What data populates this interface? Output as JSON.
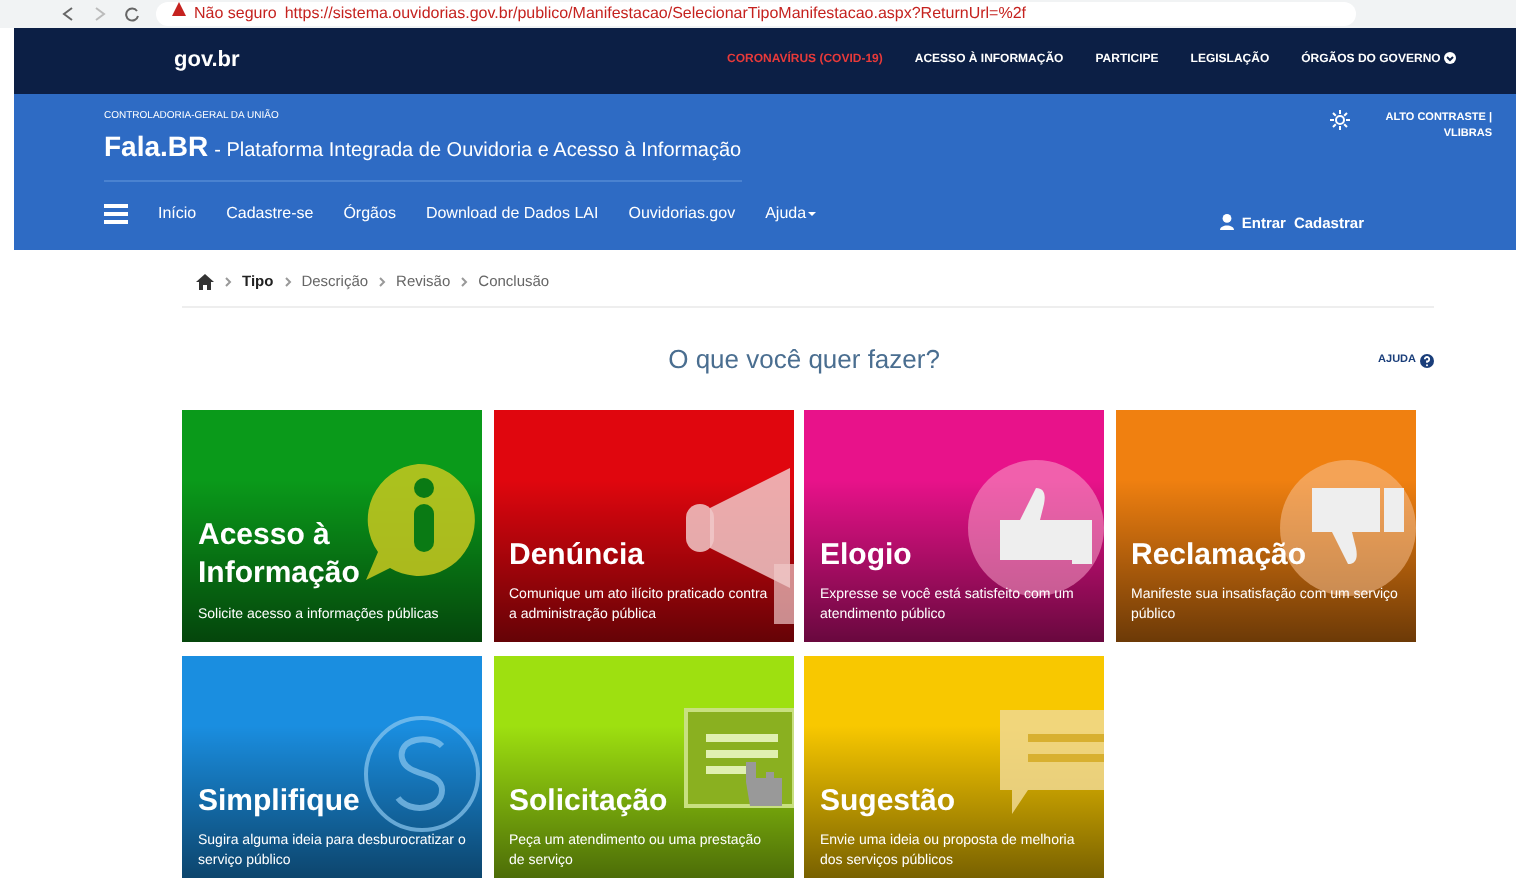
{
  "browser": {
    "warning": "Não seguro",
    "url": "https://sistema.ouvidorias.gov.br/publico/Manifestacao/SelecionarTipoManifestacao.aspx?ReturnUrl=%2f"
  },
  "topbar": {
    "logo": "gov.br",
    "links": [
      {
        "label": "CORONAVÍRUS (COVID-19)",
        "kind": "alert"
      },
      {
        "label": "ACESSO À INFORMAÇÃO",
        "kind": "link"
      },
      {
        "label": "PARTICIPE",
        "kind": "link"
      },
      {
        "label": "LEGISLAÇÃO",
        "kind": "link"
      },
      {
        "label": "ÓRGÃOS DO GOVERNO",
        "kind": "dropdown"
      }
    ]
  },
  "header": {
    "agency": "CONTROLADORIA-GERAL DA UNIÃO",
    "brand": "Fala.BR",
    "subtitle": "- Plataforma Integrada de Ouvidoria e Acesso à Informação",
    "contrast": "ALTO CONTRASTE |",
    "vlibras": "VLIBRAS"
  },
  "nav": [
    {
      "label": "Início",
      "kind": "link"
    },
    {
      "label": "Cadastre-se",
      "kind": "link"
    },
    {
      "label": "Órgãos",
      "kind": "link"
    },
    {
      "label": "Download de Dados LAI",
      "kind": "link"
    },
    {
      "label": "Ouvidorias.gov",
      "kind": "link"
    },
    {
      "label": "Ajuda",
      "kind": "dropdown"
    }
  ],
  "user_links": [
    "Entrar",
    "Cadastrar"
  ],
  "breadcrumb": [
    {
      "label": "Tipo",
      "selected": true
    },
    {
      "label": "Descrição",
      "selected": false
    },
    {
      "label": "Revisão",
      "selected": false
    },
    {
      "label": "Conclusão",
      "selected": false
    }
  ],
  "title": "O que você quer fazer?",
  "help": "AJUDA",
  "tiles": [
    {
      "title": "Acesso à Informação",
      "description": "Solicite acesso a informações públicas",
      "color": "#0a9a1a",
      "kind": "info"
    },
    {
      "title": "Denúncia",
      "description": "Comunique um ato ilícito praticado contra a administração pública",
      "color": "#e0060e",
      "kind": "megaphone"
    },
    {
      "title": "Elogio",
      "description": "Expresse se você está satisfeito com um atendimento público",
      "color": "#e8128a",
      "kind": "thumbs-up"
    },
    {
      "title": "Reclamação",
      "description": "Manifeste sua insatisfação com um serviço público",
      "color": "#f08010",
      "kind": "thumbs-down"
    },
    {
      "title": "Simplifique",
      "description": "Sugira alguma ideia para desburocratizar o serviço público",
      "color": "#1a8ee0",
      "kind": "cycle"
    },
    {
      "title": "Solicitação",
      "description": "Peça um atendimento ou uma prestação de serviço",
      "color": "#9ee010",
      "kind": "screen"
    },
    {
      "title": "Sugestão",
      "description": "Envie uma ideia ou proposta de melhoria dos serviços públicos",
      "color": "#f8c800",
      "kind": "chat"
    }
  ]
}
